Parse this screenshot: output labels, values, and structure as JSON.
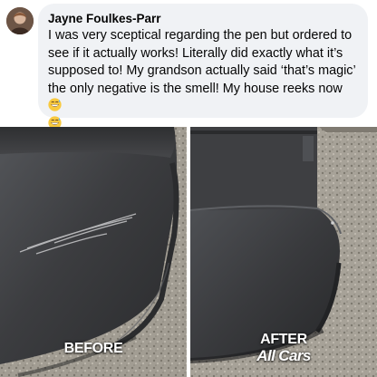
{
  "review": {
    "author": "Jayne Foulkes-Parr",
    "text": "I was very sceptical regarding the pen but ordered to see if it actually works! Literally did exactly what it’s supposed to! My grandson actually said ‘that’s magic’ the only negative is the smell! My house reeks now",
    "emoji": [
      "grinning-sweat-emoji",
      "grinning-sweat-emoji"
    ]
  },
  "photos": {
    "before_label": "BEFORE",
    "after_label": "AFTER",
    "brand_label": "All Cars"
  },
  "colors": {
    "bubble": "#f0f2f5",
    "bumper": "#3a3b3e",
    "gravel": "#9a958c",
    "divider": "#ffffff"
  }
}
